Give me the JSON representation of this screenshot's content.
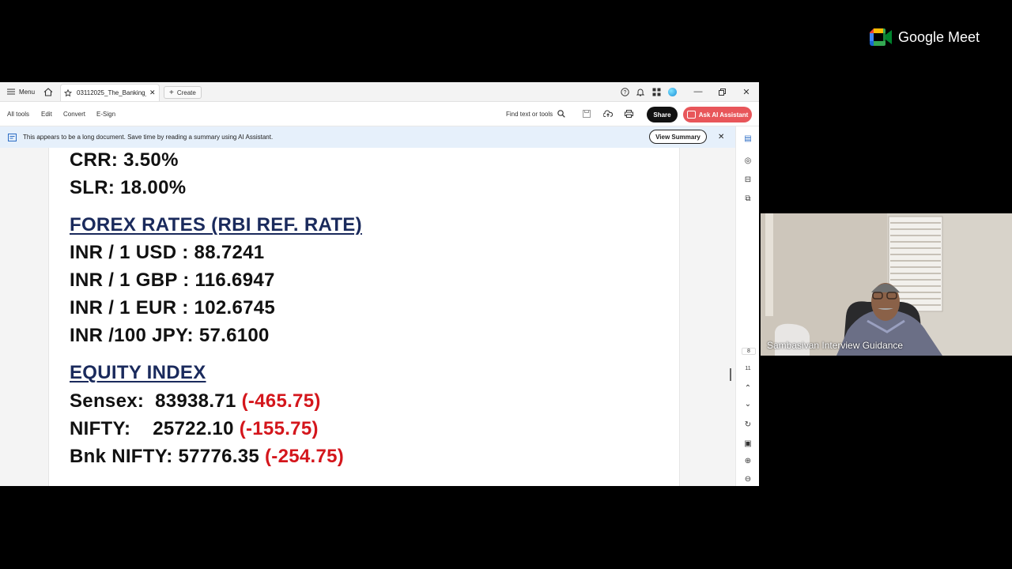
{
  "meet": {
    "brand": "Google Meet",
    "participant_name": "Sambasivan Interview Guidance"
  },
  "acrobat": {
    "tabbar": {
      "menu": "Menu",
      "tab_title": "03112025_The_Banking_...",
      "create": "Create"
    },
    "toolbar": {
      "all_tools": "All tools",
      "edit": "Edit",
      "convert": "Convert",
      "esign": "E-Sign",
      "find": "Find text or tools",
      "share": "Share",
      "ai_assistant": "Ask AI Assistant"
    },
    "banner": {
      "text": "This appears to be a long document. Save time by reading a summary using AI Assistant.",
      "view_summary": "View Summary"
    },
    "rail": {
      "page_current": "8",
      "page_total": "11"
    }
  },
  "document": {
    "crr": "CRR: 3.50%",
    "slr": "SLR: 18.00%",
    "forex_heading": "FOREX RATES (RBI REF. RATE)",
    "forex": [
      "INR / 1 USD : 88.7241",
      "INR / 1 GBP : 116.6947",
      "INR / 1 EUR : 102.6745",
      "INR /100 JPY: 57.6100"
    ],
    "equity_heading": "EQUITY INDEX",
    "equity": [
      {
        "label": "Sensex:  83938.71 ",
        "change": "(-465.75)"
      },
      {
        "label": "NIFTY:    25722.10 ",
        "change": "(-155.75)"
      },
      {
        "label": "Bnk NIFTY: 57776.35 ",
        "change": "(-254.75)"
      }
    ]
  },
  "colors": {
    "heading": "#1a2a5c",
    "negative": "#d4161c",
    "ai_button": "#e8565a",
    "banner_bg": "#e6f0fb"
  },
  "icons": [
    "menu-icon",
    "home-icon",
    "star-icon",
    "close-icon",
    "plus-icon",
    "help-icon",
    "bell-icon",
    "apps-icon",
    "minimize-icon",
    "restore-icon",
    "search-icon",
    "save-icon",
    "upload-icon",
    "print-icon",
    "ai-icon",
    "comment-icon",
    "bookmark-icon",
    "pages-icon",
    "chevron-up-icon",
    "chevron-down-icon",
    "refresh-icon",
    "zoom-in-icon",
    "zoom-out-icon"
  ]
}
